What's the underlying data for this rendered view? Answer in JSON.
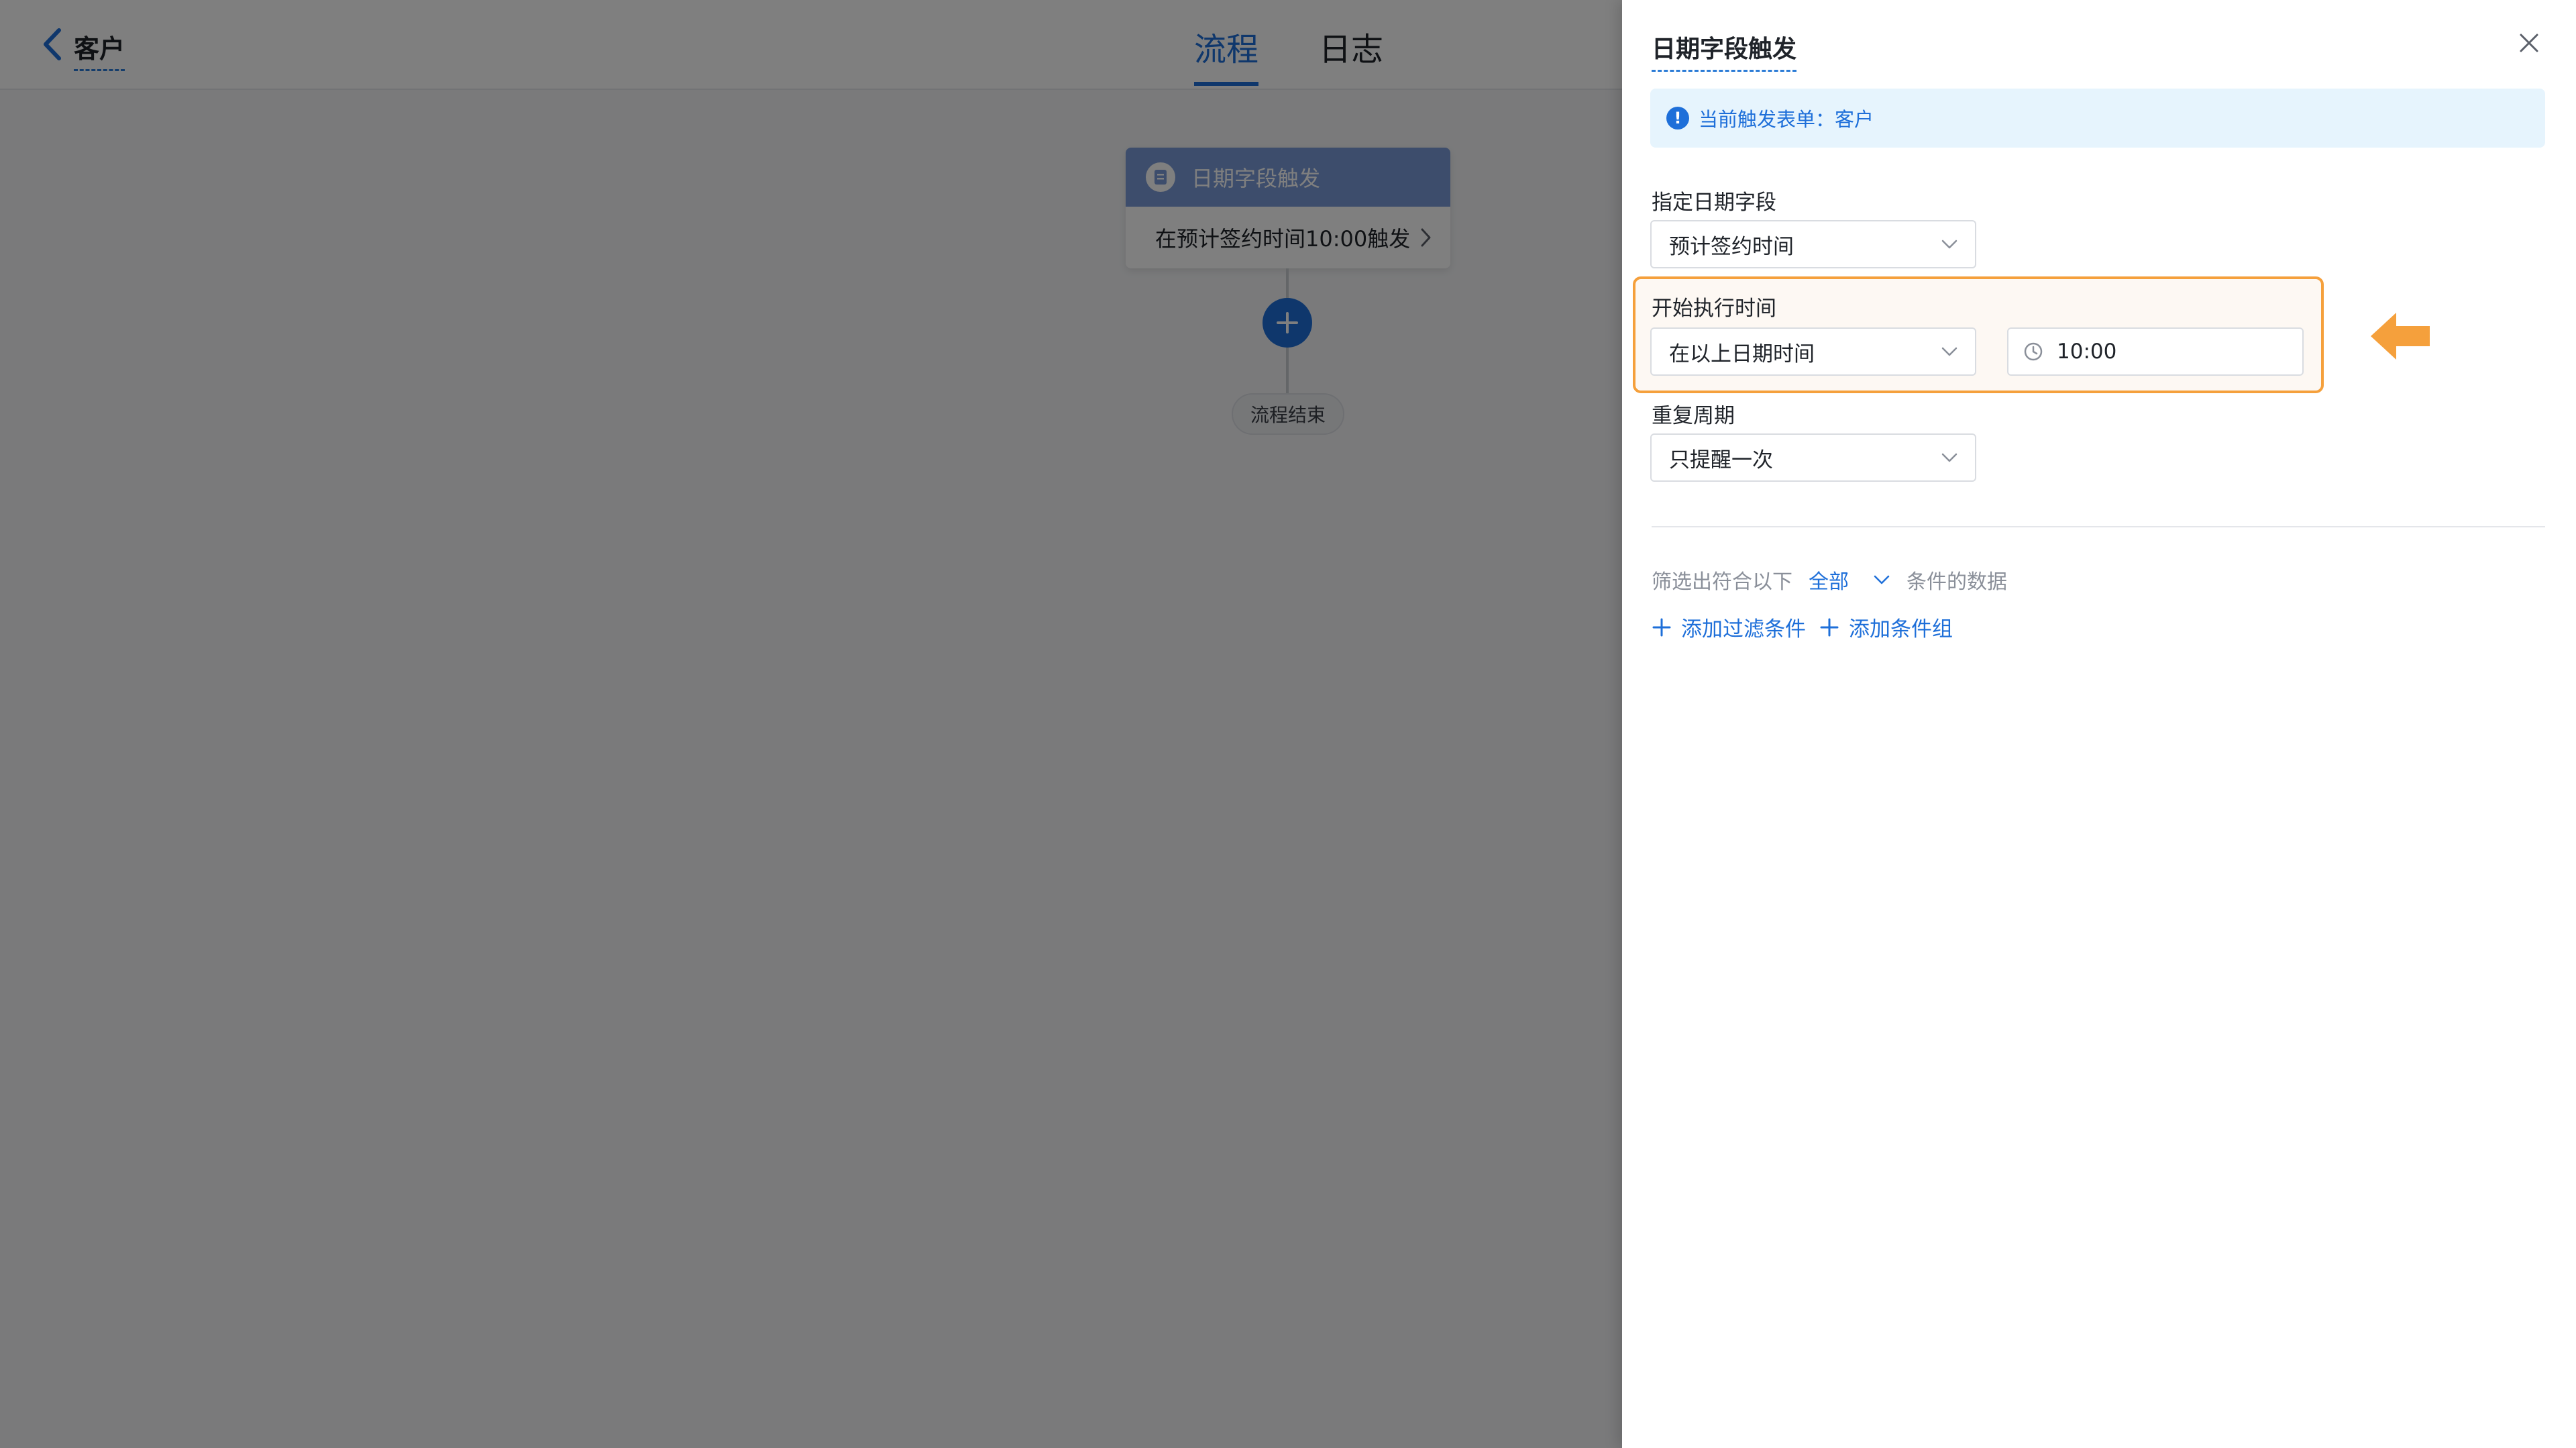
{
  "header": {
    "title": "客户",
    "tabs": [
      {
        "label": "流程",
        "active": true
      },
      {
        "label": "日志",
        "active": false
      }
    ]
  },
  "canvas": {
    "trigger_node": {
      "title": "日期字段触发",
      "summary": "在预计签约时间10:00触发"
    },
    "end_node_label": "流程结束"
  },
  "drawer": {
    "title": "日期字段触发",
    "info_banner": "当前触发表单：客户",
    "date_field": {
      "label": "指定日期字段",
      "value": "预计签约时间"
    },
    "start_time": {
      "label": "开始执行时间",
      "mode_value": "在以上日期时间",
      "time_value": "10:00"
    },
    "repeat": {
      "label": "重复周期",
      "value": "只提醒一次"
    },
    "filter": {
      "prefix": "筛选出符合以下",
      "mode": "全部",
      "suffix": "条件的数据"
    },
    "actions": {
      "add_condition": "添加过滤条件",
      "add_group": "添加条件组"
    }
  },
  "colors": {
    "accent": "#1e6fd9",
    "highlight": "#f5a03c",
    "info_bg": "#e6f4fd",
    "overlay": "rgba(0,0,0,0.5)"
  }
}
